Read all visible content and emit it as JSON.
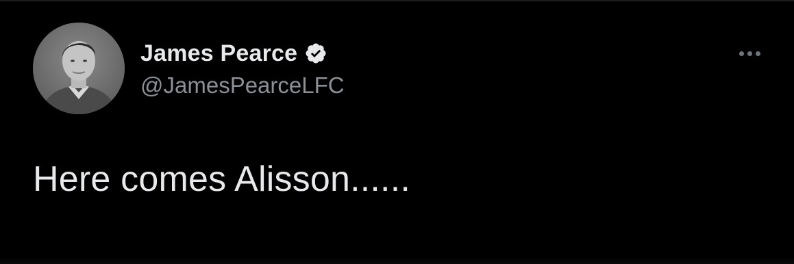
{
  "tweet": {
    "author": {
      "display_name": "James Pearce",
      "handle": "@JamesPearceLFC",
      "verified": true,
      "avatar_icon": "profile-photo"
    },
    "text": "Here comes Alisson......",
    "more_icon": "ellipsis-icon"
  },
  "colors": {
    "background": "#000000",
    "primary_text": "#e7e9ea",
    "secondary_text": "#8b9096",
    "verified_badge": "#e7e9ea"
  }
}
